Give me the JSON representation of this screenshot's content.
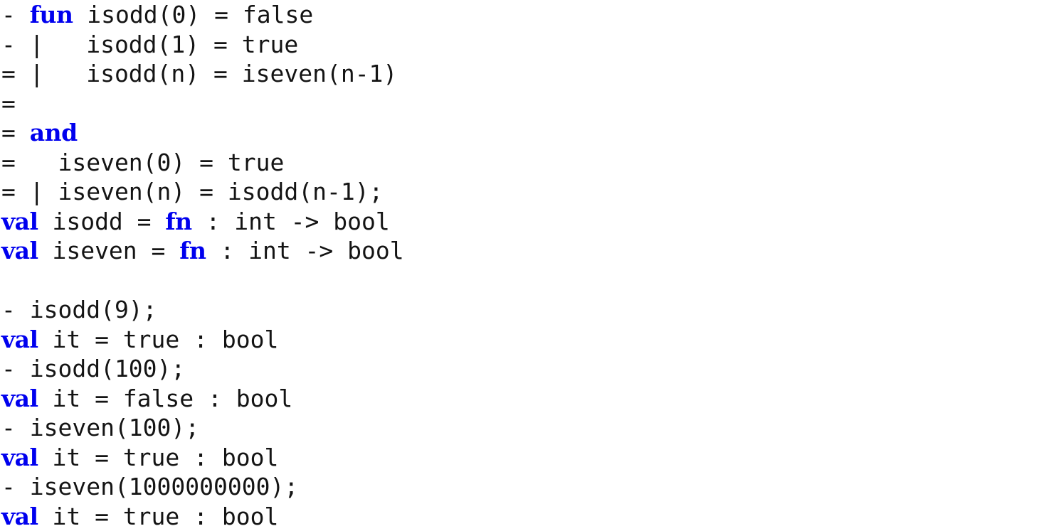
{
  "terminal": {
    "app": "Standard ML REPL transcript",
    "background_color": "#ffffff",
    "text_color": "#141414",
    "keyword_color": "#0000ee",
    "font_size_px": 33,
    "line_height_px": 41.5,
    "prompt_primary": "-",
    "prompt_continuation": "=",
    "total_lines": 16
  },
  "lines": [
    {
      "index": 0,
      "kind": "input",
      "prompt": "-",
      "segments": [
        {
          "type": "plain",
          "text": "- "
        },
        {
          "type": "keyword",
          "text": "fun"
        },
        {
          "type": "plain",
          "text": " isodd(0) = false"
        }
      ],
      "raw": "- fun isodd(0) = false"
    },
    {
      "index": 1,
      "kind": "input",
      "prompt": "-",
      "segments": [
        {
          "type": "plain",
          "text": "- |   isodd(1) = true"
        }
      ],
      "raw": "- |   isodd(1) = true"
    },
    {
      "index": 2,
      "kind": "input",
      "prompt": "=",
      "segments": [
        {
          "type": "plain",
          "text": "= |   isodd(n) = iseven(n-1)"
        }
      ],
      "raw": "= |   isodd(n) = iseven(n-1)"
    },
    {
      "index": 3,
      "kind": "input",
      "prompt": "=",
      "segments": [
        {
          "type": "plain",
          "text": "="
        }
      ],
      "raw": "="
    },
    {
      "index": 4,
      "kind": "input",
      "prompt": "=",
      "segments": [
        {
          "type": "plain",
          "text": "= "
        },
        {
          "type": "keyword",
          "text": "and"
        }
      ],
      "raw": "= and"
    },
    {
      "index": 5,
      "kind": "input",
      "prompt": "=",
      "segments": [
        {
          "type": "plain",
          "text": "=   iseven(0) = true"
        }
      ],
      "raw": "=   iseven(0) = true"
    },
    {
      "index": 6,
      "kind": "input",
      "prompt": "=",
      "segments": [
        {
          "type": "plain",
          "text": "= | iseven(n) = isodd(n-1);"
        }
      ],
      "raw": "= | iseven(n) = isodd(n-1);"
    },
    {
      "index": 7,
      "kind": "output",
      "prompt": "",
      "segments": [
        {
          "type": "keyword",
          "text": "val"
        },
        {
          "type": "plain",
          "text": " isodd = "
        },
        {
          "type": "keyword",
          "text": "fn"
        },
        {
          "type": "plain",
          "text": " : int -> bool"
        }
      ],
      "raw": "val isodd = fn : int -> bool"
    },
    {
      "index": 8,
      "kind": "output",
      "prompt": "",
      "segments": [
        {
          "type": "keyword",
          "text": "val"
        },
        {
          "type": "plain",
          "text": " iseven = "
        },
        {
          "type": "keyword",
          "text": "fn"
        },
        {
          "type": "plain",
          "text": " : int -> bool"
        }
      ],
      "raw": "val iseven = fn : int -> bool"
    },
    {
      "index": 9,
      "kind": "blank",
      "prompt": "",
      "segments": [
        {
          "type": "plain",
          "text": " "
        }
      ],
      "raw": ""
    },
    {
      "index": 10,
      "kind": "input",
      "prompt": "-",
      "segments": [
        {
          "type": "plain",
          "text": "- isodd(9);"
        }
      ],
      "raw": "- isodd(9);"
    },
    {
      "index": 11,
      "kind": "output",
      "prompt": "",
      "segments": [
        {
          "type": "keyword",
          "text": "val"
        },
        {
          "type": "plain",
          "text": " it = true : bool"
        }
      ],
      "raw": "val it = true : bool"
    },
    {
      "index": 12,
      "kind": "input",
      "prompt": "-",
      "segments": [
        {
          "type": "plain",
          "text": "- isodd(100);"
        }
      ],
      "raw": "- isodd(100);"
    },
    {
      "index": 13,
      "kind": "output",
      "prompt": "",
      "segments": [
        {
          "type": "keyword",
          "text": "val"
        },
        {
          "type": "plain",
          "text": " it = false : bool"
        }
      ],
      "raw": "val it = false : bool"
    },
    {
      "index": 14,
      "kind": "input",
      "prompt": "-",
      "segments": [
        {
          "type": "plain",
          "text": "- iseven(100);"
        }
      ],
      "raw": "- iseven(100);"
    },
    {
      "index": 15,
      "kind": "output",
      "prompt": "",
      "segments": [
        {
          "type": "keyword",
          "text": "val"
        },
        {
          "type": "plain",
          "text": " it = true : bool"
        }
      ],
      "raw": "val it = true : bool"
    },
    {
      "index": 16,
      "kind": "input",
      "prompt": "-",
      "segments": [
        {
          "type": "plain",
          "text": "- iseven(1000000000);"
        }
      ],
      "raw": "- iseven(1000000000);"
    },
    {
      "index": 17,
      "kind": "output",
      "prompt": "",
      "segments": [
        {
          "type": "keyword",
          "text": "val"
        },
        {
          "type": "plain",
          "text": " it = true : bool"
        }
      ],
      "raw": "val it = true : bool"
    }
  ]
}
